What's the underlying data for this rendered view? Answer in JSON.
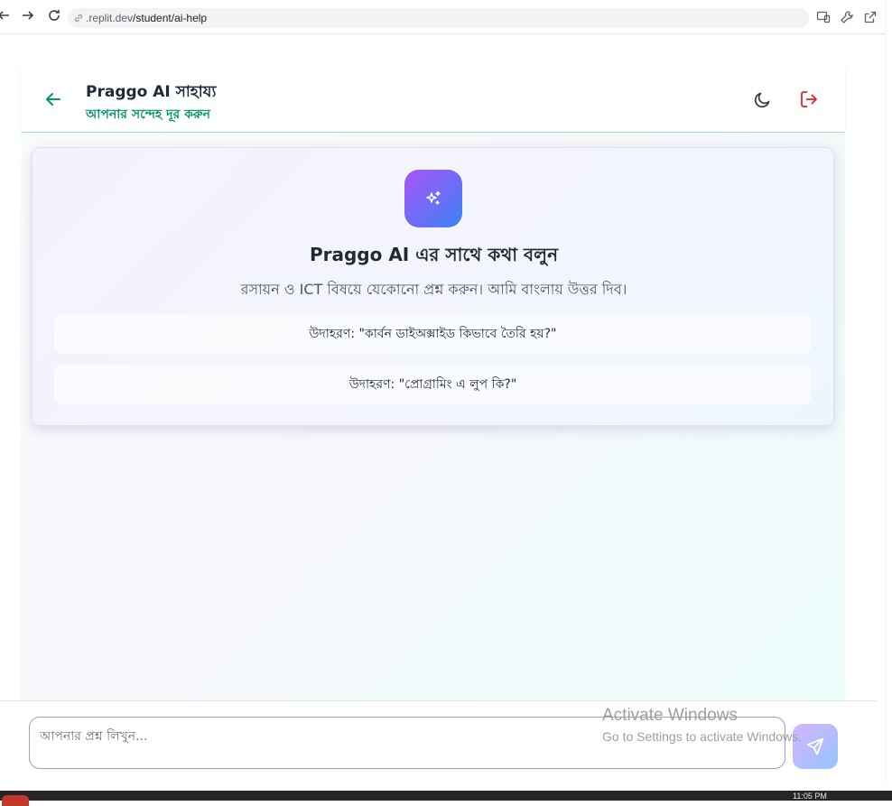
{
  "browser": {
    "url_host": ".replit.dev",
    "url_path": "/student/ai-help"
  },
  "header": {
    "title": "Praggo AI সাহায্য",
    "subtitle": "আপনার সন্দেহ দূর করুন"
  },
  "welcome": {
    "title": "Praggo AI এর সাথে কথা বলুন",
    "description": "রসায়ন ও ICT বিষয়ে যেকোনো প্রশ্ন করুন। আমি বাংলায় উত্তর দিব।",
    "examples": [
      "উদাহরণ: \"কার্বন ডাইঅক্সাইড কিভাবে তৈরি হয়?\"",
      "উদাহরণ: \"প্রোগ্রামিং এ লুপ কি?\""
    ]
  },
  "composer": {
    "placeholder": "আপনার প্রশ্ন লিখুন..."
  },
  "watermark": {
    "line1": "Activate Windows",
    "line2": "Go to Settings to activate Windows."
  },
  "taskbar": {
    "clock": "11:05 PM"
  },
  "colors": {
    "accent_green": "#059669",
    "logout_red": "#dc2626",
    "gradient_purple": "#a855f7",
    "gradient_blue": "#3b82f6"
  },
  "icons": {
    "back": "arrow-left-icon",
    "theme": "moon-icon",
    "logout": "logout-icon",
    "ai": "sparkles-icon",
    "send": "send-icon"
  }
}
